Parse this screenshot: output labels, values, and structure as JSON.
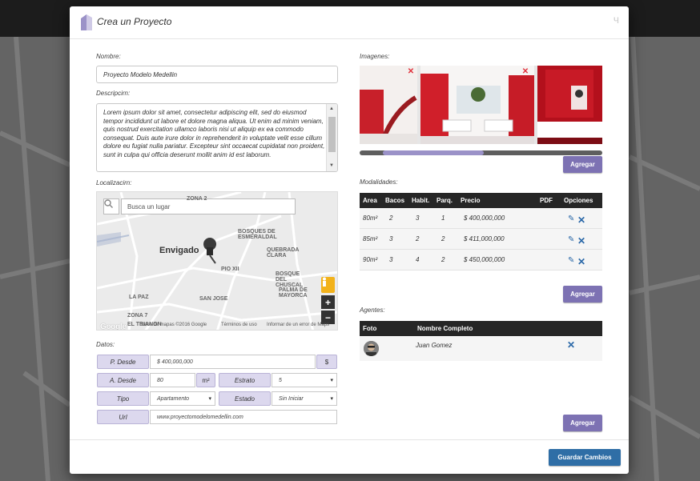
{
  "modal": {
    "title": "Crea un Proyecto",
    "close_glyph": "ч"
  },
  "form": {
    "nombre_label": "Nombre:",
    "nombre_value": "Proyecto Modelo Medellin",
    "descripcion_label": "Descripcirn:",
    "descripcion_value": "Lorem ipsum dolor sit amet, consectetur adipiscing elit, sed do eiusmod tempor incididunt ut labore et dolore magna aliqua. Ut enim ad minim veniam, quis nostrud exercitation ullamco laboris nisi ut aliquip ex ea commodo consequat. Duis aute irure dolor in reprehenderit in voluptate velit esse cillum dolore eu fugiat nulla pariatur. Excepteur sint occaecat cupidatat non proident, sunt in culpa qui officia deserunt mollit anim id est laborum.",
    "localizacion_label": "Localizacirn:",
    "datos_label": "Datos:"
  },
  "map": {
    "search_placeholder": "Busca un lugar",
    "city": "Envigado",
    "places": [
      "ZONA 2",
      "BOSQUES DE ESMERALDAL",
      "QUEBRADA CLARA",
      "PIO XII",
      "BOSQUE DEL CHUSCAL",
      "PALMA DE MAYORCA",
      "LA PAZ",
      "SAN JOSE",
      "ZONA 7",
      "EL TRIANON"
    ],
    "footer_data": "Datos de mapas ©2016 Google",
    "footer_terms": "Términos de uso",
    "footer_report": "Informar de un error de Maps",
    "google": "Google",
    "zoom_in": "+",
    "zoom_out": "−"
  },
  "datos": {
    "p_desde_label": "P. Desde",
    "p_desde_value": "$ 400,000,000",
    "p_desde_unit": "$",
    "a_desde_label": "A. Desde",
    "a_desde_value": "80",
    "a_desde_unit": "m²",
    "estrato_label": "Estrato",
    "estrato_value": "5",
    "tipo_label": "Tipo",
    "tipo_value": "Apartamento",
    "estado_label": "Estado",
    "estado_value": "Sin Iniciar",
    "url_label": "Url",
    "url_value": "www.proyectomodelomedellin.com"
  },
  "imagenes": {
    "label": "Imagenes:",
    "agregar": "Agregar"
  },
  "modalidades": {
    "label": "Modalidades:",
    "headers": [
      "Area",
      "Bacos",
      "Habit.",
      "Parq.",
      "Precio",
      "PDF",
      "Opciones"
    ],
    "rows": [
      {
        "area": "80m²",
        "banos": "2",
        "habit": "3",
        "parq": "1",
        "precio": "$ 400,000,000"
      },
      {
        "area": "85m²",
        "banos": "3",
        "habit": "2",
        "parq": "2",
        "precio": "$ 411,000,000"
      },
      {
        "area": "90m²",
        "banos": "3",
        "habit": "4",
        "parq": "2",
        "precio": "$ 450,000,000"
      }
    ],
    "agregar": "Agregar"
  },
  "agentes": {
    "label": "Agentes:",
    "headers": [
      "Foto",
      "Nombre Completo"
    ],
    "rows": [
      {
        "nombre": "Juan Gomez"
      }
    ],
    "agregar": "Agregar"
  },
  "footer": {
    "save_label": "Guardar Cambios"
  },
  "colors": {
    "accent_purple": "#7d72b3",
    "save_blue": "#2f6ea6",
    "table_header": "#262626",
    "label_box": "#dcd8ee"
  }
}
